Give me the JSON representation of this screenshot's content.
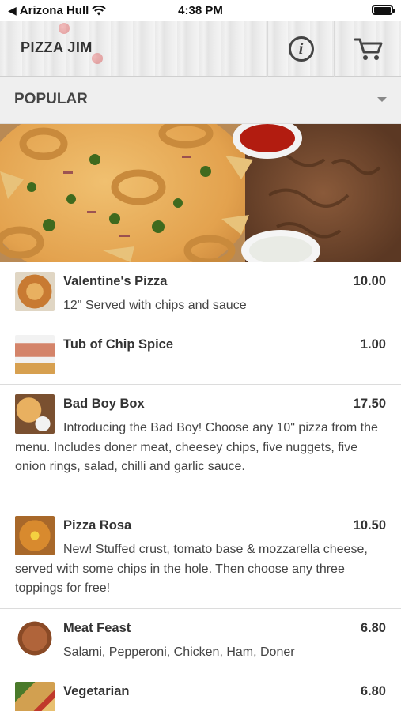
{
  "status_bar": {
    "carrier": "Arizona Hull",
    "time": "4:38 PM"
  },
  "header": {
    "title": "PIZZA JIM",
    "info_icon": "info-icon",
    "cart_icon": "cart-icon"
  },
  "category": {
    "selected": "POPULAR"
  },
  "menu_items": [
    {
      "name": "Valentine's Pizza",
      "price": "10.00",
      "description": "12\" Served with chips and sauce"
    },
    {
      "name": "Tub of Chip Spice",
      "price": "1.00",
      "description": ""
    },
    {
      "name": "Bad Boy Box",
      "price": "17.50",
      "description": "Introducing the Bad Boy! Choose any 10\" pizza from the menu. Includes doner meat, cheesey chips, five nuggets, five onion rings, salad, chilli and garlic sauce."
    },
    {
      "name": "Pizza Rosa",
      "price": "10.50",
      "description": "New! Stuffed crust, tomato base & mozzarella cheese, served with some chips in the hole. Then choose any three toppings for free!"
    },
    {
      "name": "Meat Feast",
      "price": "6.80",
      "description": "Salami, Pepperoni, Chicken, Ham, Doner"
    },
    {
      "name": "Vegetarian",
      "price": "6.80",
      "description": ""
    }
  ],
  "colors": {
    "header_bg": "#ececec",
    "category_bg": "#efefef",
    "text": "#333333",
    "divider": "#dcdcdc"
  }
}
